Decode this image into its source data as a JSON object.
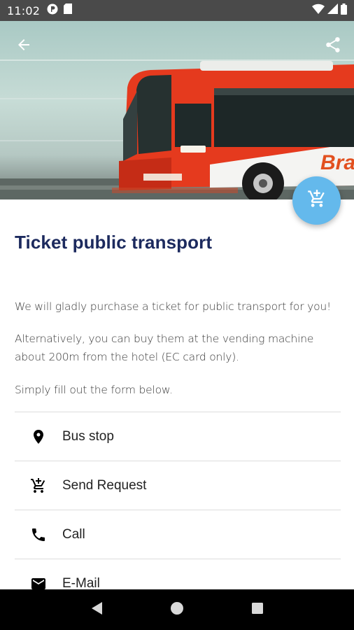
{
  "status_bar": {
    "time": "11:02",
    "left_icons": [
      "app-notification-icon",
      "sd-card-icon"
    ],
    "right_icons": [
      "wifi-icon",
      "cell-signal-icon",
      "battery-icon"
    ]
  },
  "hero": {
    "image": "red-bus-photo",
    "bus_text": "Bra",
    "back_icon": "arrow-back-icon",
    "share_icon": "share-icon"
  },
  "fab": {
    "icon": "cart-icon",
    "color": "#64b9ec"
  },
  "page": {
    "title": "Ticket public transport",
    "paragraphs": [
      "We will gladly purchase a ticket for public transport for you!",
      "Alternatively, you can buy them at the vending machine about 200m from the hotel (EC card only).",
      "Simply fill out the form below."
    ]
  },
  "actions": [
    {
      "label": "Bus stop",
      "icon": "location-pin-icon"
    },
    {
      "label": "Send Request",
      "icon": "cart-icon"
    },
    {
      "label": "Call",
      "icon": "phone-icon"
    },
    {
      "label": "E-Mail",
      "icon": "email-icon"
    }
  ],
  "nav_bar": {
    "buttons": [
      "back-triangle-icon",
      "home-circle-icon",
      "recents-square-icon"
    ]
  },
  "colors": {
    "title": "#1c2a5e",
    "accent": "#64b9ec",
    "status_bar": "#4a4a4a"
  }
}
